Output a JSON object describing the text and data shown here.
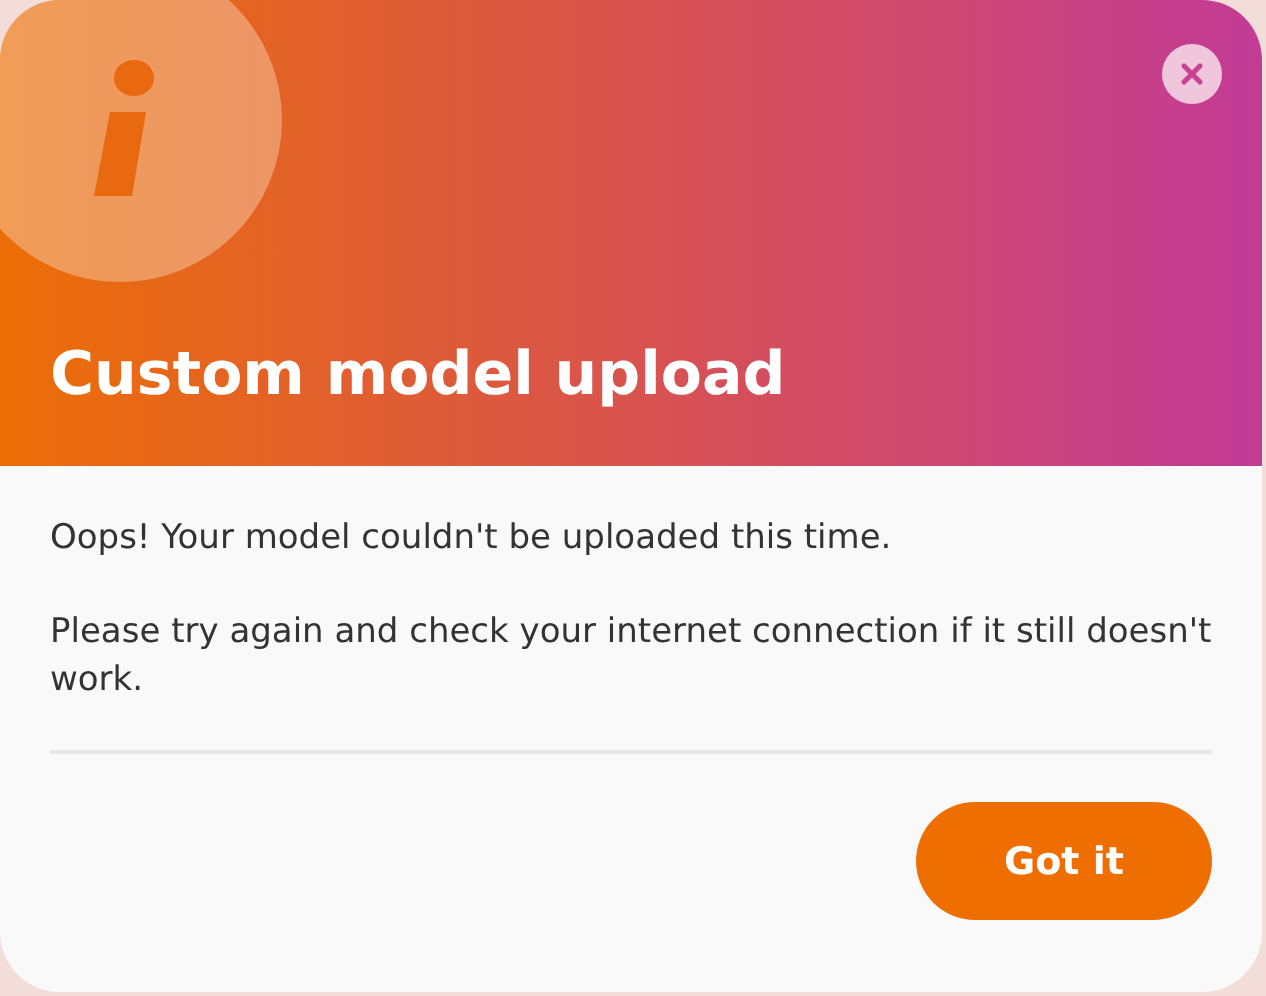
{
  "dialog": {
    "title": "Custom model upload",
    "paragraphs": [
      "Oops! Your model couldn't be uploaded this time.",
      "Please try again and check your internet connection if it still doesn't work."
    ],
    "buttons": [
      {
        "label": "Got it",
        "kind": "primary"
      }
    ]
  }
}
